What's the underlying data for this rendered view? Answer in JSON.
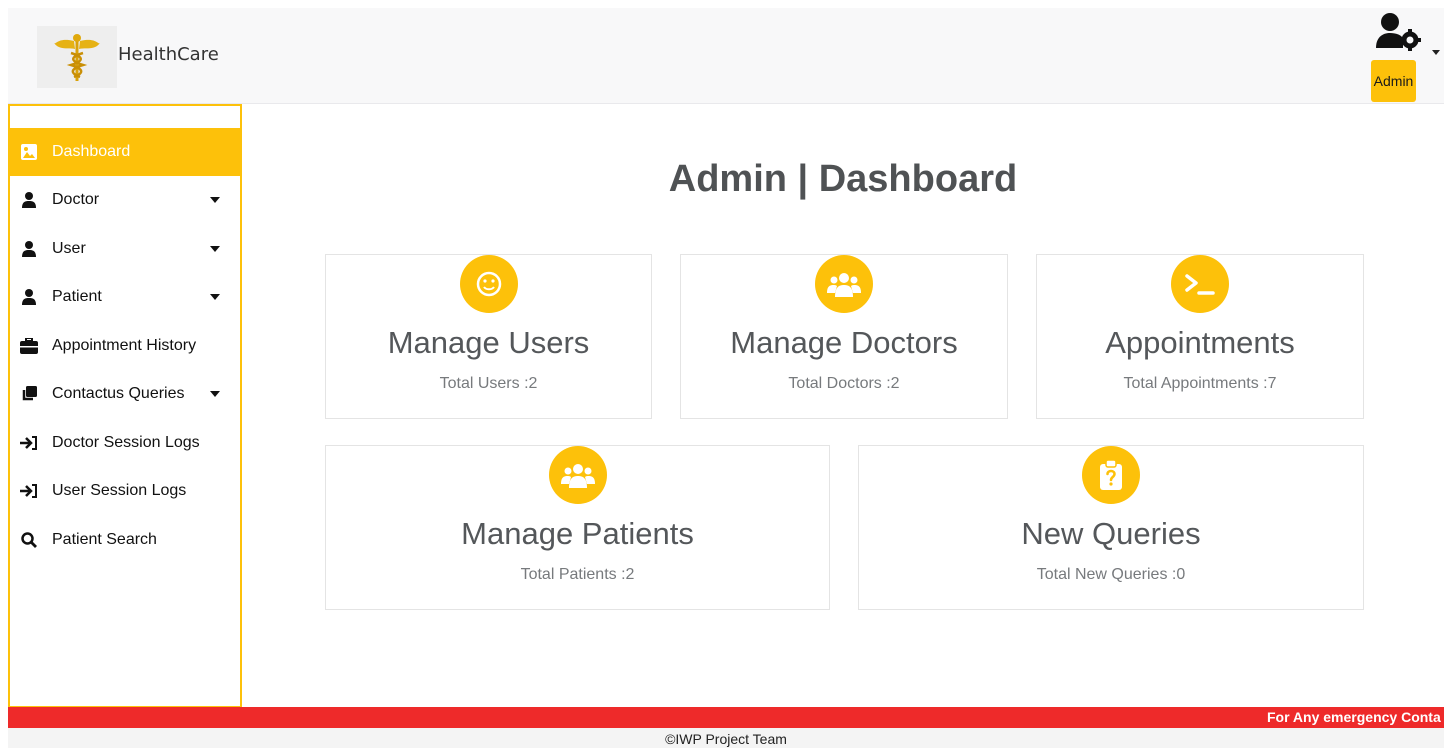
{
  "header": {
    "brand": "HealthCare",
    "admin_label": "Admin"
  },
  "sidebar": {
    "items": [
      {
        "label": "Dashboard",
        "icon": "image-icon",
        "has_caret": false,
        "active": true
      },
      {
        "label": "Doctor",
        "icon": "user-icon",
        "has_caret": true
      },
      {
        "label": "User",
        "icon": "user-icon",
        "has_caret": true
      },
      {
        "label": "Patient",
        "icon": "user-icon",
        "has_caret": true
      },
      {
        "label": "Appointment History",
        "icon": "briefcase-icon",
        "has_caret": false
      },
      {
        "label": "Contactus Queries",
        "icon": "copy-icon",
        "has_caret": true
      },
      {
        "label": "Doctor Session Logs",
        "icon": "sign-in-icon",
        "has_caret": false
      },
      {
        "label": "User Session Logs",
        "icon": "sign-in-icon",
        "has_caret": false
      },
      {
        "label": "Patient Search",
        "icon": "search-icon",
        "has_caret": false
      }
    ]
  },
  "main": {
    "title": "Admin | Dashboard",
    "cards": [
      {
        "title": "Manage Users",
        "count": "Total Users :2",
        "icon": "smile-icon"
      },
      {
        "title": "Manage Doctors",
        "count": "Total Doctors :2",
        "icon": "users-icon"
      },
      {
        "title": "Appointments",
        "count": "Total Appointments :7",
        "icon": "terminal-icon"
      },
      {
        "title": "Manage Patients",
        "count": "Total Patients :2",
        "icon": "users-icon"
      },
      {
        "title": "New Queries",
        "count": "Total New Queries :0",
        "icon": "clipboard-question-icon"
      }
    ]
  },
  "emergency": {
    "text": "For Any emergency Conta"
  },
  "footer": {
    "text": "©IWP Project Team"
  },
  "colors": {
    "accent": "#fdc10a",
    "emergency": "#ee2a2a",
    "title": "#4f5254"
  }
}
